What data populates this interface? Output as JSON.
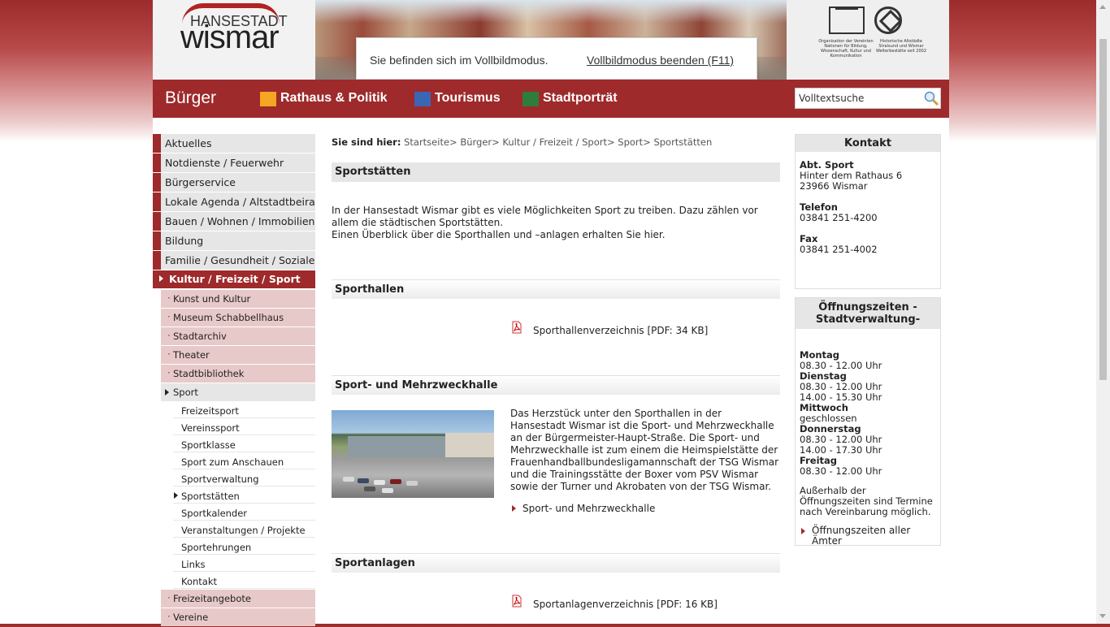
{
  "header": {
    "logo_top": "HANSESTADT",
    "logo_main": "wismar",
    "unesco_left": "Organisation der Vereinten Nationen für Bildung, Wissenschaft, Kultur und Kommunikation",
    "unesco_right": "Historische Altstädte Stralsund und Wismar Welterbestätte seit 2002"
  },
  "fullscreen_notice": {
    "text": "Sie befinden sich im Vollbildmodus.",
    "exit_link": "Vollbildmodus beenden (F11)"
  },
  "nav": {
    "current": "Bürger",
    "items": [
      {
        "label": "Rathaus & Politik",
        "color": "#f5a623"
      },
      {
        "label": "Tourismus",
        "color": "#3a66b5"
      },
      {
        "label": "Stadtporträt",
        "color": "#2e7d3a"
      }
    ],
    "search_value": "Volltextsuche"
  },
  "leftnav": {
    "main_items": [
      "Aktuelles",
      "Notdienste / Feuerwehr",
      "Bürgerservice",
      "Lokale Agenda / Altstadtbeirat",
      "Bauen / Wohnen / Immobilien",
      "Bildung",
      "Familie / Gesundheit / Soziales"
    ],
    "active": "Kultur / Freizeit / Sport",
    "sub_items": [
      "Kunst und Kultur",
      "Museum Schabbellhaus",
      "Stadtarchiv",
      "Theater",
      "Stadtbibliothek"
    ],
    "sub_open": "Sport",
    "subsub_items": [
      "Freizeitsport",
      "Vereinssport",
      "Sportklasse",
      "Sport zum Anschauen",
      "Sportverwaltung",
      "Sportstätten",
      "Sportkalender",
      "Veranstaltungen / Projekte",
      "Sportehrungen",
      "Links",
      "Kontakt"
    ],
    "sub_items_after": [
      "Freizeitangebote",
      "Vereine"
    ]
  },
  "breadcrumb": {
    "label": "Sie sind hier:",
    "path": "Startseite> Bürger> Kultur / Freizeit / Sport> Sport> Sportstätten"
  },
  "main": {
    "title": "Sportstätten",
    "intro_1": "In der Hansestadt Wismar gibt es viele Möglichkeiten Sport zu treiben. Dazu zählen vor allem die städtischen Sportstätten.",
    "intro_2": "Einen Überblick über die Sporthallen und –anlagen erhalten Sie hier.",
    "sec1_title": "Sporthallen",
    "sec1_link": "Sporthallenverzeichnis [PDF: 34 KB]",
    "sec2_title": "Sport- und Mehrzweckhalle",
    "sec2_text": "Das Herzstück unter den Sporthallen in der Hansestadt Wismar ist die Sport- und Mehrzweckhalle an der Bürgermeister-Haupt-Straße. Die Sport- und Mehrzweckhalle ist zum einem die Heimspielstätte der Frauenhandballbundesligamannschaft der TSG Wismar und die Trainingsstätte der Boxer vom PSV Wismar sowie der Turner und Akrobaten von der TSG Wismar.",
    "sec2_link": "Sport- und Mehrzweckhalle",
    "sec3_title": "Sportanlagen",
    "sec3_link": "Sportanlagenverzeichnis [PDF: 16 KB]"
  },
  "kontakt": {
    "title": "Kontakt",
    "org": "Abt. Sport",
    "street": "Hinter dem Rathaus 6",
    "city": "23966 Wismar",
    "tel_label": "Telefon",
    "tel": "03841 251-4200",
    "fax_label": "Fax",
    "fax": "03841 251-4002"
  },
  "hours": {
    "title": "Öffnungszeiten -Stadtverwaltung-",
    "monday": "Montag",
    "monday_1": "08.30 - 12.00 Uhr",
    "tuesday": "Dienstag",
    "tuesday_1": "08.30 - 12.00 Uhr",
    "tuesday_2": "14.00 - 15.30 Uhr",
    "wednesday": "Mittwoch",
    "wednesday_1": "geschlossen",
    "thursday": "Donnerstag",
    "thursday_1": "08.30 - 12.00 Uhr",
    "thursday_2": "14.00 - 17.30 Uhr",
    "friday": "Freitag",
    "friday_1": "08.30 - 12.00 Uhr",
    "note": "Außerhalb der Öffnungszeiten sind Termine nach Vereinbarung möglich.",
    "link": "Öffnungszeiten aller Ämter"
  },
  "colors": {
    "brand_red": "#9e2a2b",
    "sub_pink": "#e8c9c9",
    "grey": "#e6e6e6"
  }
}
